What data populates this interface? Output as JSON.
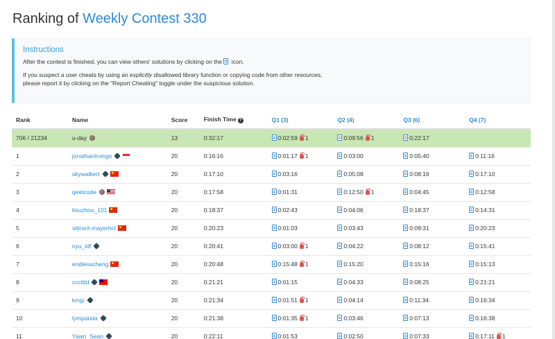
{
  "page": {
    "title_prefix": "Ranking of ",
    "title_contest": "Weekly Contest 330"
  },
  "instructions": {
    "title": "Instructions",
    "line1_before": "After the contest is finished, you can view others' solutions by clicking on the ",
    "line1_after": " icon.",
    "line2_before": "If you suspect a user cheats by using an ",
    "line2_em": "explicitly",
    "line2_after": " disallowed library function or copying code from other resources,",
    "line3": "please report it by clicking on the \"Report Cheating\" toggle under the suspicious solution."
  },
  "table": {
    "headers": {
      "rank": "Rank",
      "name": "Name",
      "score": "Score",
      "finish": "Finish Time",
      "q1": "Q1 (3)",
      "q2": "Q2 (4)",
      "q3": "Q3 (6)",
      "q4": "Q4 (7)"
    },
    "rows": [
      {
        "rank": "706 / 21234",
        "name": "u-day",
        "score": "13",
        "finish": "0:32:17",
        "q1": "0:02:59",
        "q1_bug": "1",
        "q2": "0:09:56",
        "q2_bug": "1",
        "q3": "0:22:17",
        "q3_bug": "",
        "q4": "",
        "q4_bug": ""
      },
      {
        "rank": "1",
        "name": "jonathanirvings",
        "score": "20",
        "finish": "0:16:16",
        "q1": "0:01:17",
        "q1_bug": "1",
        "q2": "0:03:00",
        "q2_bug": "",
        "q3": "0:05:40",
        "q3_bug": "",
        "q4": "0:11:16",
        "q4_bug": ""
      },
      {
        "rank": "2",
        "name": "skywalkert",
        "score": "20",
        "finish": "0:17:10",
        "q1": "0:03:16",
        "q1_bug": "",
        "q2": "0:05:08",
        "q2_bug": "",
        "q3": "0:08:16",
        "q3_bug": "",
        "q4": "0:17:10",
        "q4_bug": ""
      },
      {
        "rank": "3",
        "name": "qeetcode",
        "score": "20",
        "finish": "0:17:58",
        "q1": "0:01:31",
        "q1_bug": "",
        "q2": "0:12:50",
        "q2_bug": "1",
        "q3": "0:04:45",
        "q3_bug": "",
        "q4": "0:12:58",
        "q4_bug": ""
      },
      {
        "rank": "4",
        "name": "liouzhou_101",
        "score": "20",
        "finish": "0:18:37",
        "q1": "0:02:43",
        "q1_bug": "",
        "q2": "0:04:06",
        "q2_bug": "",
        "q3": "0:18:37",
        "q3_bug": "",
        "q4": "0:14:31",
        "q4_bug": ""
      },
      {
        "rank": "5",
        "name": "vibrant-mayerhct",
        "score": "20",
        "finish": "0:20:23",
        "q1": "0:01:03",
        "q1_bug": "",
        "q2": "0:03:43",
        "q2_bug": "",
        "q3": "0:09:31",
        "q3_bug": "",
        "q4": "0:20:23",
        "q4_bug": ""
      },
      {
        "rank": "6",
        "name": "nyu_ldf",
        "score": "20",
        "finish": "0:20:41",
        "q1": "0:03:00",
        "q1_bug": "1",
        "q2": "0:04:22",
        "q2_bug": "",
        "q3": "0:08:12",
        "q3_bug": "",
        "q4": "0:15:41",
        "q4_bug": ""
      },
      {
        "rank": "7",
        "name": "endlesscheng",
        "score": "20",
        "finish": "0:20:48",
        "q1": "0:15:48",
        "q1_bug": "1",
        "q2": "0:15:20",
        "q2_bug": "",
        "q3": "0:15:16",
        "q3_bug": "",
        "q4": "0:15:13",
        "q4_bug": ""
      },
      {
        "rank": "8",
        "name": "ccctttd",
        "score": "20",
        "finish": "0:21:21",
        "q1": "0:01:15",
        "q1_bug": "",
        "q2": "0:04:33",
        "q2_bug": "",
        "q3": "0:08:25",
        "q3_bug": "",
        "q4": "0:21:21",
        "q4_bug": ""
      },
      {
        "rank": "9",
        "name": "kmjp",
        "score": "20",
        "finish": "0:21:34",
        "q1": "0:01:51",
        "q1_bug": "1",
        "q2": "0:04:14",
        "q2_bug": "",
        "q3": "0:11:34",
        "q3_bug": "",
        "q4": "0:16:34",
        "q4_bug": ""
      },
      {
        "rank": "10",
        "name": "lympanda",
        "score": "20",
        "finish": "0:21:38",
        "q1": "0:01:35",
        "q1_bug": "1",
        "q2": "0:03:46",
        "q2_bug": "",
        "q3": "0:07:13",
        "q3_bug": "",
        "q4": "0:16:38",
        "q4_bug": ""
      },
      {
        "rank": "11",
        "name": "Yawn_Sean",
        "score": "20",
        "finish": "0:22:11",
        "q1": "0:01:53",
        "q1_bug": "",
        "q2": "0:02:50",
        "q2_bug": "",
        "q3": "0:07:33",
        "q3_bug": "",
        "q4": "0:17:11",
        "q4_bug": "1"
      }
    ]
  }
}
